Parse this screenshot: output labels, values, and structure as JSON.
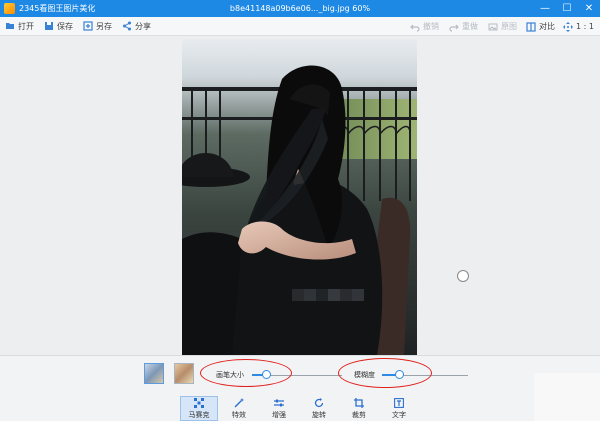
{
  "titlebar": {
    "app_title": "2345看图王图片美化",
    "file_title": "b8e41148a09b6e06..._big.jpg  60%",
    "controls": {
      "minimize": "—",
      "maximize": "☐",
      "close": "✕"
    }
  },
  "toolbar": {
    "open": "打开",
    "save": "保存",
    "save_as": "另存",
    "share": "分享",
    "undo": "撤销",
    "redo": "重做",
    "original": "原图",
    "compare": "对比",
    "ratio": "1 : 1"
  },
  "bottom": {
    "brush_size_label": "画笔大小",
    "brush_size_value": 0.15,
    "blur_label": "模糊度",
    "blur_value": 0.2,
    "tools": [
      {
        "label": "马赛克",
        "icon": "mosaic-icon"
      },
      {
        "label": "特效",
        "icon": "magic-wand-icon"
      },
      {
        "label": "增强",
        "icon": "sliders-icon"
      },
      {
        "label": "旋转",
        "icon": "rotate-icon"
      },
      {
        "label": "裁剪",
        "icon": "crop-icon"
      },
      {
        "label": "文字",
        "icon": "text-icon"
      }
    ]
  },
  "colors": {
    "titlebar": "#1e88e5",
    "accent": "#2d8ae6",
    "annotation": "#e0201b"
  }
}
